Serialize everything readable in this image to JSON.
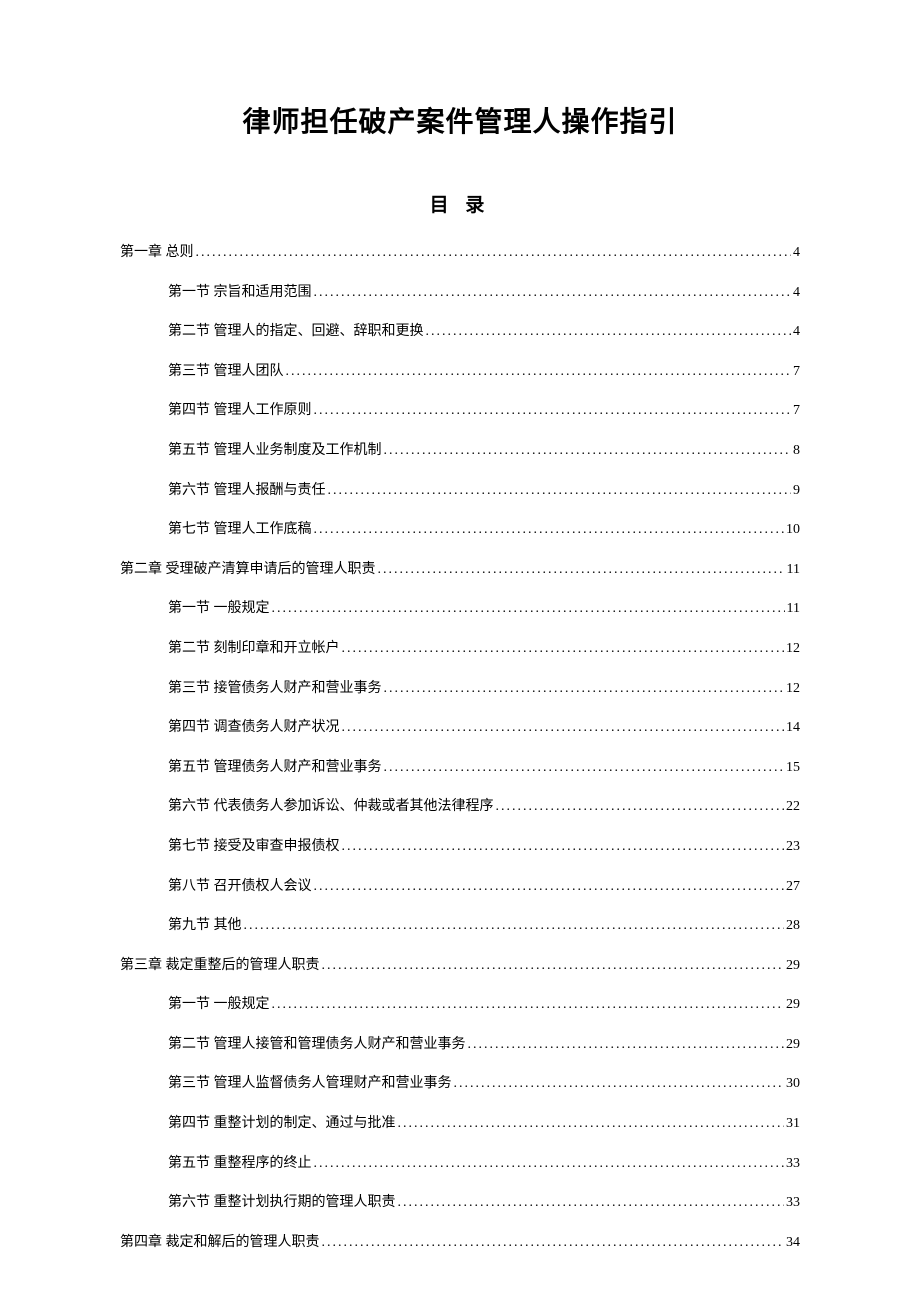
{
  "title": "律师担任破产案件管理人操作指引",
  "toc_heading": "目 录",
  "toc": [
    {
      "level": 1,
      "label": "第一章 总则",
      "page": "4"
    },
    {
      "level": 2,
      "label": "第一节 宗旨和适用范围",
      "page": "4"
    },
    {
      "level": 2,
      "label": "第二节 管理人的指定、回避、辞职和更换",
      "page": "4"
    },
    {
      "level": 2,
      "label": "第三节 管理人团队",
      "page": "7"
    },
    {
      "level": 2,
      "label": "第四节 管理人工作原则",
      "page": "7"
    },
    {
      "level": 2,
      "label": "第五节 管理人业务制度及工作机制",
      "page": "8"
    },
    {
      "level": 2,
      "label": "第六节 管理人报酬与责任",
      "page": "9"
    },
    {
      "level": 2,
      "label": "第七节 管理人工作底稿",
      "page": "10"
    },
    {
      "level": 1,
      "label": "第二章  受理破产清算申请后的管理人职责",
      "page": "11"
    },
    {
      "level": 2,
      "label": "第一节  一般规定",
      "page": "11"
    },
    {
      "level": 2,
      "label": "第二节  刻制印章和开立帐户",
      "page": "12"
    },
    {
      "level": 2,
      "label": "第三节  接管债务人财产和营业事务",
      "page": "12"
    },
    {
      "level": 2,
      "label": "第四节  调查债务人财产状况",
      "page": "14"
    },
    {
      "level": 2,
      "label": "第五节  管理债务人财产和营业事务",
      "page": "15"
    },
    {
      "level": 2,
      "label": "第六节  代表债务人参加诉讼、仲裁或者其他法律程序",
      "page": "22"
    },
    {
      "level": 2,
      "label": "第七节  接受及审查申报债权",
      "page": "23"
    },
    {
      "level": 2,
      "label": "第八节  召开债权人会议",
      "page": "27"
    },
    {
      "level": 2,
      "label": "第九节  其他",
      "page": "28"
    },
    {
      "level": 1,
      "label": "第三章 裁定重整后的管理人职责",
      "page": "29"
    },
    {
      "level": 2,
      "label": "第一节 一般规定",
      "page": "29"
    },
    {
      "level": 2,
      "label": "第二节 管理人接管和管理债务人财产和营业事务",
      "page": "29"
    },
    {
      "level": 2,
      "label": "第三节 管理人监督债务人管理财产和营业事务",
      "page": "30"
    },
    {
      "level": 2,
      "label": "第四节 重整计划的制定、通过与批准",
      "page": "31"
    },
    {
      "level": 2,
      "label": "第五节 重整程序的终止",
      "page": "33"
    },
    {
      "level": 2,
      "label": "第六节 重整计划执行期的管理人职责",
      "page": "33"
    },
    {
      "level": 1,
      "label": "第四章 裁定和解后的管理人职责",
      "page": "34"
    }
  ]
}
